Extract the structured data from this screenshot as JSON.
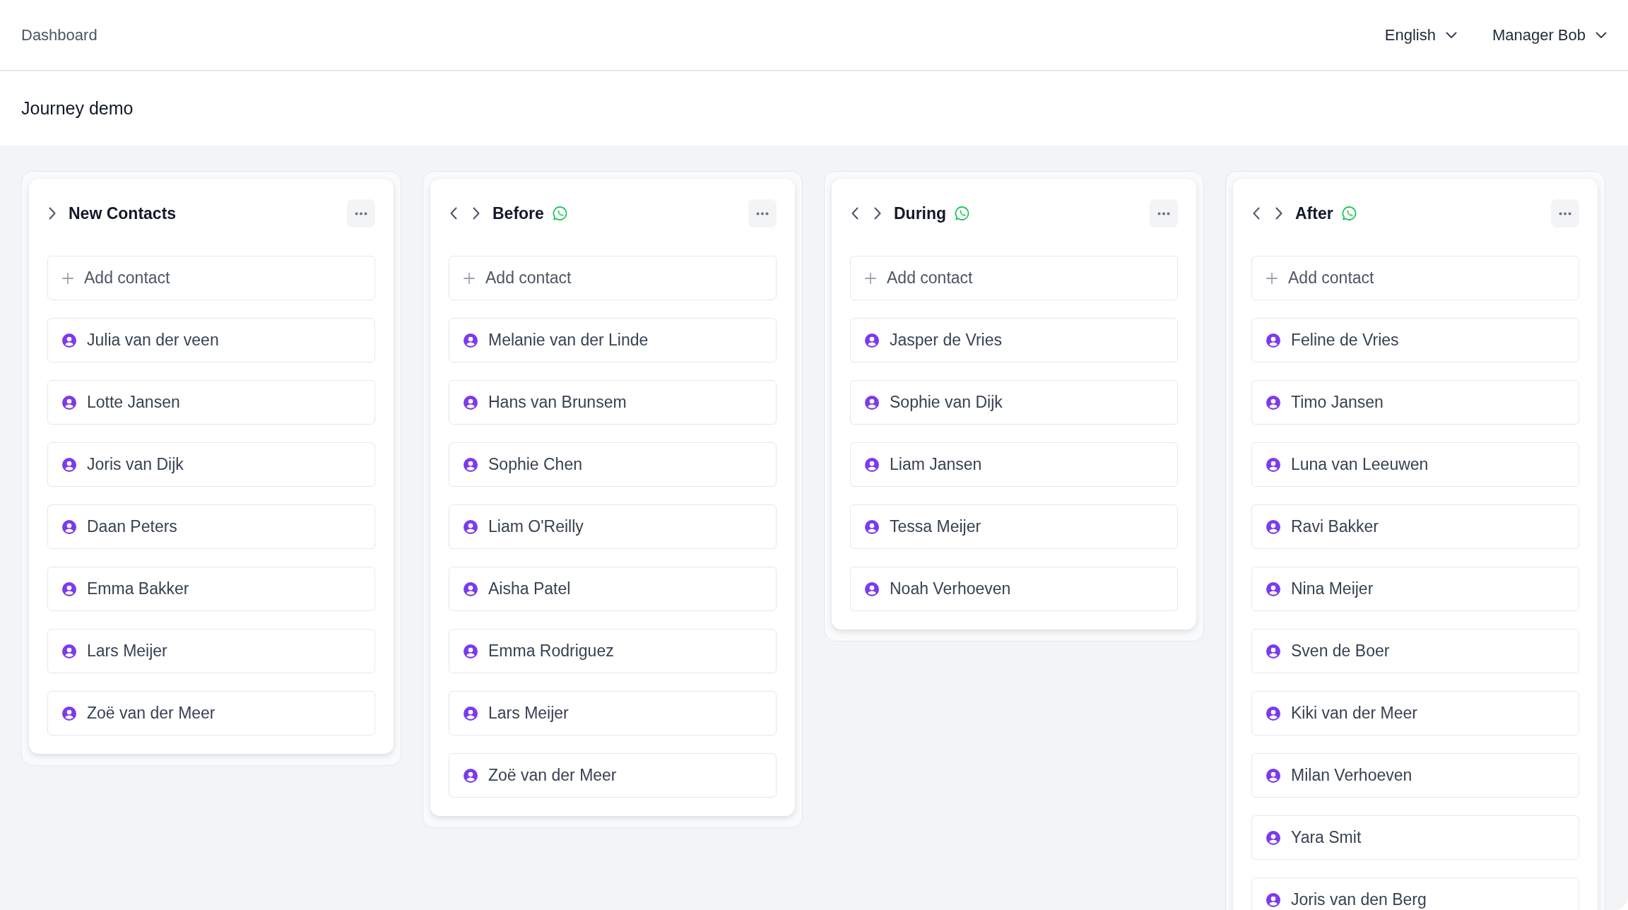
{
  "header": {
    "breadcrumb": "Dashboard",
    "language": "English",
    "user": "Manager Bob"
  },
  "page_title": "Journey demo",
  "columns": [
    {
      "title": "New Contacts",
      "can_move_left": false,
      "can_move_right": true,
      "whatsapp": false,
      "add_label": "Add contact",
      "contacts": [
        "Julia van der veen",
        "Lotte Jansen",
        "Joris van Dijk",
        "Daan Peters",
        "Emma Bakker",
        "Lars Meijer",
        "Zoë van der Meer"
      ]
    },
    {
      "title": "Before",
      "can_move_left": true,
      "can_move_right": true,
      "whatsapp": true,
      "add_label": "Add contact",
      "contacts": [
        "Melanie van der Linde",
        "Hans van Brunsem",
        "Sophie Chen",
        "Liam O'Reilly",
        "Aisha Patel",
        "Emma Rodriguez",
        "Lars Meijer",
        "Zoë van der Meer"
      ]
    },
    {
      "title": "During",
      "can_move_left": true,
      "can_move_right": true,
      "whatsapp": true,
      "add_label": "Add contact",
      "contacts": [
        "Jasper de Vries",
        "Sophie van Dijk",
        "Liam Jansen",
        "Tessa Meijer",
        "Noah Verhoeven"
      ]
    },
    {
      "title": "After",
      "can_move_left": true,
      "can_move_right": true,
      "whatsapp": true,
      "add_label": "Add contact",
      "contacts": [
        "Feline de Vries",
        "Timo Jansen",
        "Luna van Leeuwen",
        "Ravi Bakker",
        "Nina Meijer",
        "Sven de Boer",
        "Kiki van der Meer",
        "Milan Verhoeven",
        "Yara Smit",
        "Joris van den Berg"
      ]
    }
  ]
}
